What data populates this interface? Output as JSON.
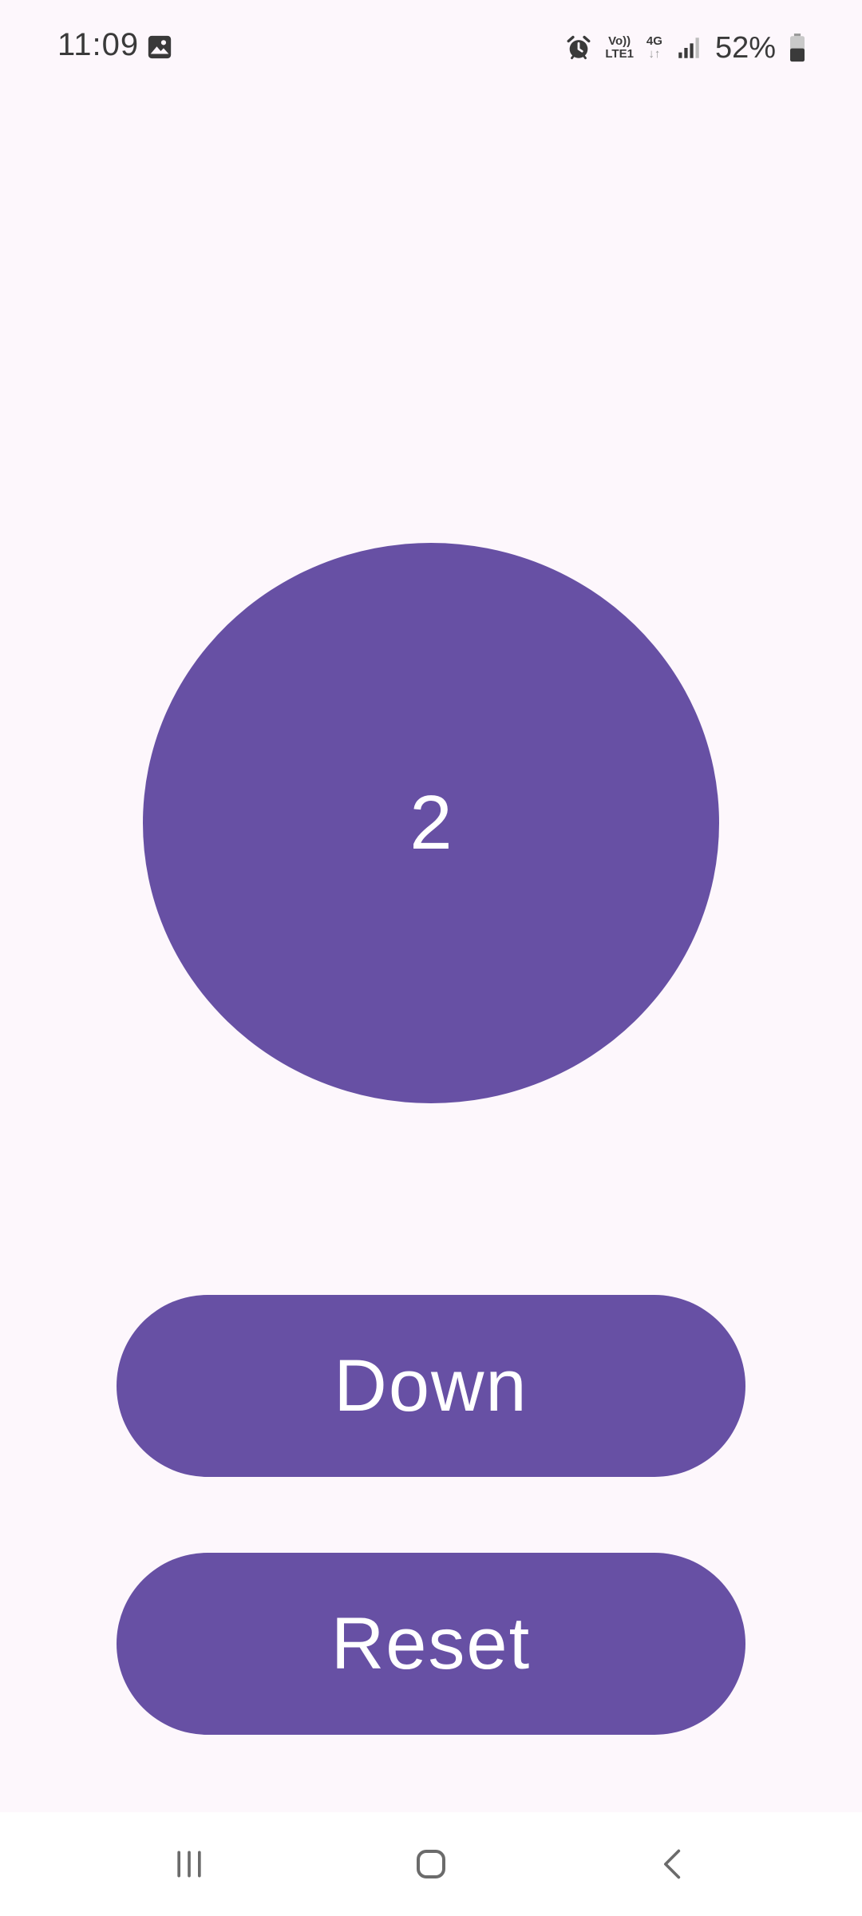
{
  "status_bar": {
    "time": "11:09",
    "volte_top": "Vo))",
    "volte_bottom": "LTE1",
    "network_type": "4G",
    "network_arrows": "↓↑",
    "battery_percent": "52%",
    "battery_level": 0.52,
    "icons": [
      "gallery-icon",
      "alarm-icon",
      "signal-icon",
      "battery-icon"
    ]
  },
  "counter": {
    "value": "2"
  },
  "buttons": {
    "down_label": "Down",
    "reset_label": "Reset"
  },
  "navigation": {
    "items": [
      "recents-icon",
      "home-icon",
      "back-icon"
    ]
  },
  "colors": {
    "primary": "#6750a4",
    "background": "#fdf7fc",
    "on_primary": "#ffffff"
  }
}
